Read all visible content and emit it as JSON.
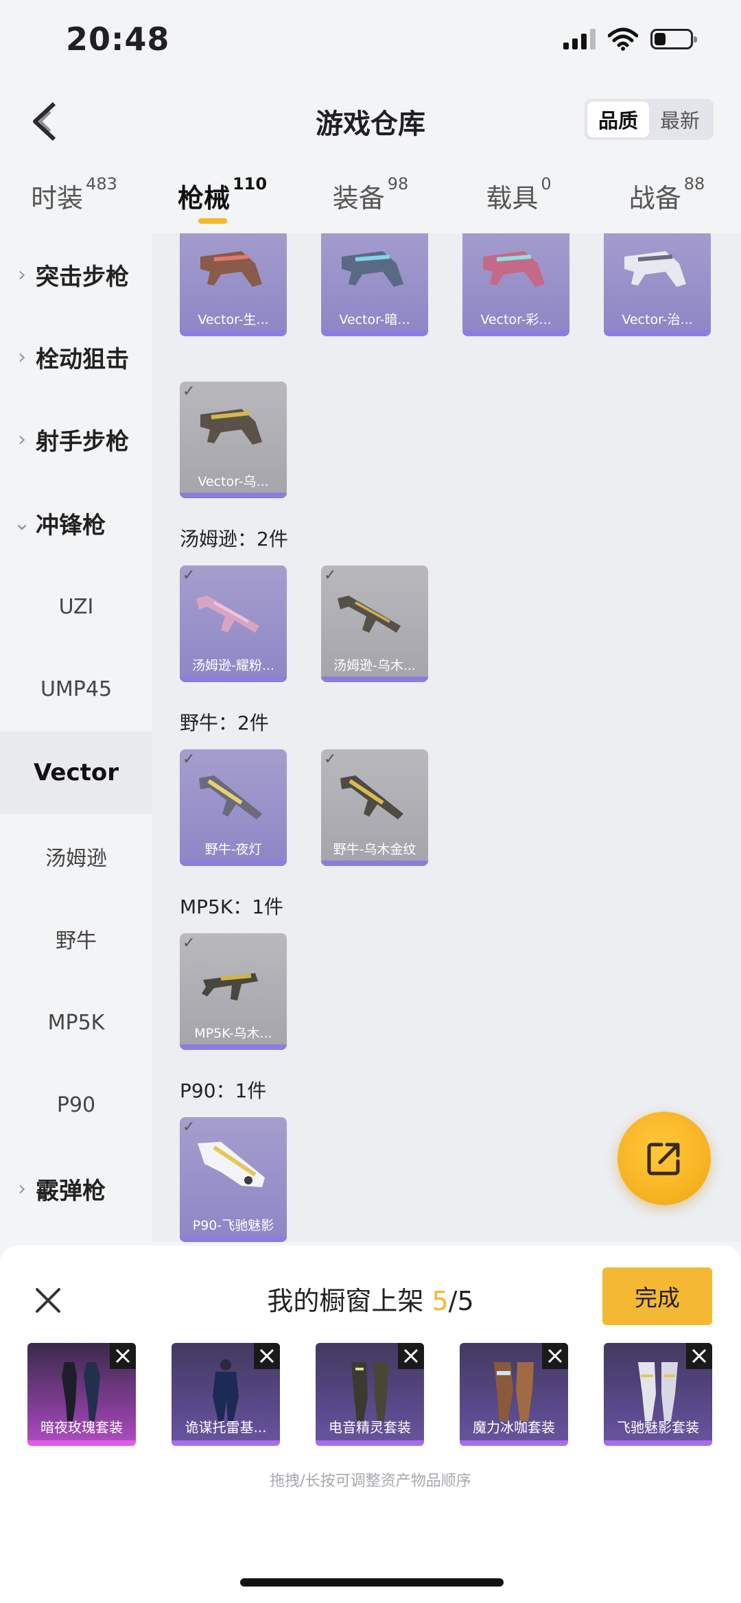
{
  "status_bar": {
    "time": "20:48"
  },
  "header": {
    "title": "游戏仓库",
    "sort": {
      "quality": "品质",
      "newest": "最新"
    }
  },
  "tabs": [
    {
      "label": "时装",
      "count": "483"
    },
    {
      "label": "枪械",
      "count": "110"
    },
    {
      "label": "装备",
      "count": "98"
    },
    {
      "label": "载具",
      "count": "0"
    },
    {
      "label": "战备",
      "count": "88"
    }
  ],
  "sidebar": {
    "categories": [
      {
        "label": "突击步枪",
        "chevron": "›"
      },
      {
        "label": "栓动狙击",
        "chevron": "›"
      },
      {
        "label": "射手步枪",
        "chevron": "›"
      },
      {
        "label": "冲锋枪",
        "chevron": "⌄"
      },
      {
        "label": "霰弹枪",
        "chevron": "›"
      }
    ],
    "subitems": [
      "UZI",
      "UMP45",
      "Vector",
      "汤姆逊",
      "野牛",
      "MP5K",
      "P90"
    ]
  },
  "content": {
    "vector_row1": [
      "Vector-生...",
      "Vector-暗...",
      "Vector-彩...",
      "Vector-治..."
    ],
    "vector_row2": [
      "Vector-乌..."
    ],
    "sections": [
      {
        "title": "汤姆逊：2件",
        "items": [
          "汤姆逊-耀粉...",
          "汤姆逊-乌木..."
        ]
      },
      {
        "title": "野牛：2件",
        "items": [
          "野牛-夜灯",
          "野牛-乌木金纹"
        ]
      },
      {
        "title": "MP5K：1件",
        "items": [
          "MP5K-乌木..."
        ]
      },
      {
        "title": "P90：1件",
        "items": [
          "P90-飞驰魅影"
        ]
      }
    ]
  },
  "sheet": {
    "title_prefix": "我的橱窗上架 ",
    "count_current": "5",
    "count_total": "/5",
    "done_label": "完成",
    "outfits": [
      "暗夜玫瑰套装",
      "诡谋托雷基...",
      "电音精灵套装",
      "魔力冰咖套装",
      "飞驰魅影套装"
    ],
    "hint": "拖拽/长按可调整资产物品顺序"
  },
  "colors": {
    "accent": "#f5b82a",
    "purple_card": "#8e86c6",
    "gray_card": "#a4a4aa"
  },
  "icons": [
    "back-arrow-icon",
    "signal-icon",
    "wifi-icon",
    "battery-icon",
    "share-icon",
    "close-icon",
    "check-icon",
    "remove-icon"
  ]
}
